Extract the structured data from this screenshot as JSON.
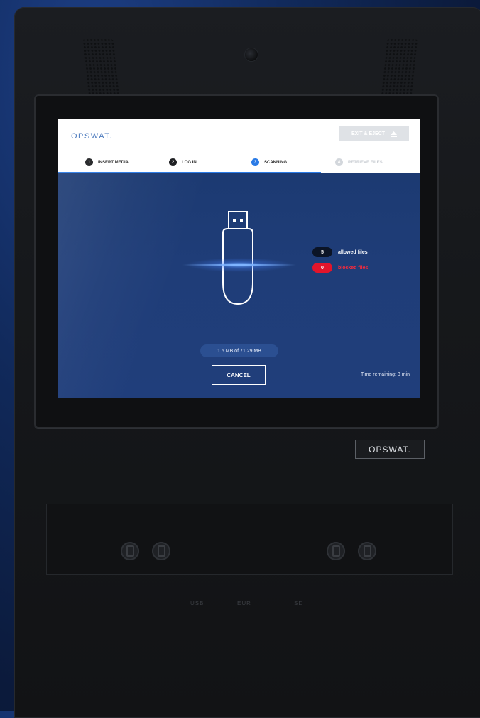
{
  "app": {
    "logo": "OPSWAT.",
    "eject_label": "EXIT & EJECT",
    "steps": [
      {
        "num": "1",
        "label": "INSERT MEDIA"
      },
      {
        "num": "2",
        "label": "LOG IN"
      },
      {
        "num": "3",
        "label": "SCANNING"
      },
      {
        "num": "4",
        "label": "RETRIEVE FILES"
      }
    ],
    "allowed": {
      "count": "5",
      "label": "allowed files"
    },
    "blocked": {
      "count": "0",
      "label": "blocked files"
    },
    "progress": "1.5 MB of 71.29 MB",
    "cancel_label": "CANCEL",
    "time_remaining": "Time remaining: 3 min"
  },
  "device": {
    "brand_plate": "OPSWAT.",
    "bottom_labels": [
      "USB",
      "EUR",
      "SD"
    ]
  },
  "colors": {
    "accent": "#2a7be6",
    "blocked": "#e3152b",
    "screen_bg": "#1f3b74"
  },
  "icons": {
    "usb": "usb-drive-icon",
    "eject": "eject-icon",
    "port": "card-slot-icon"
  }
}
